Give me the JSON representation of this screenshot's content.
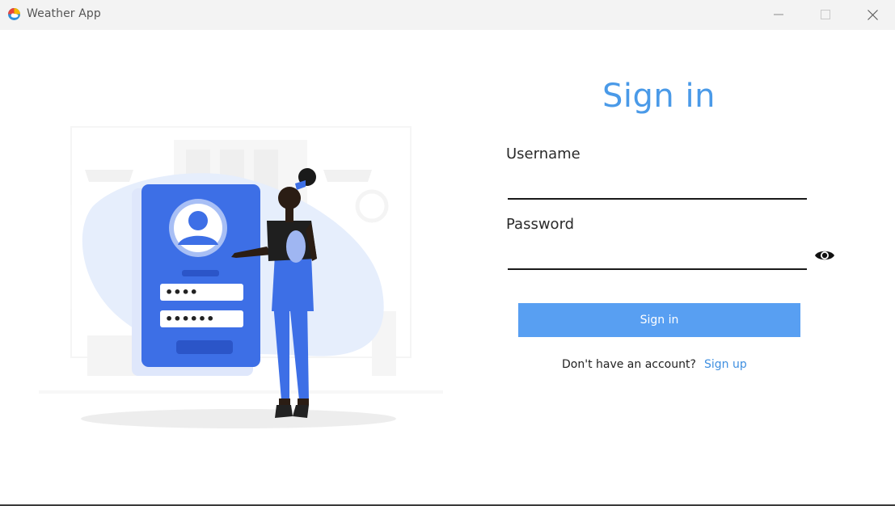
{
  "window": {
    "title": "Weather App",
    "controls": {
      "minimize_icon": "minimize-icon",
      "maximize_icon": "maximize-icon",
      "close_icon": "close-icon"
    }
  },
  "form": {
    "title": "Sign in",
    "username": {
      "label": "Username",
      "value": "",
      "placeholder": ""
    },
    "password": {
      "label": "Password",
      "value": "",
      "placeholder": "",
      "toggle_icon": "eye-icon"
    },
    "submit_label": "Sign in",
    "signup_prompt": "Don't have an account?",
    "signup_link": "Sign up"
  },
  "illustration": {
    "subject": "person-at-login-screen",
    "masked_username": "••••",
    "masked_password": "••••••"
  },
  "colors": {
    "accent": "#4a9ae8",
    "button": "#589ff2",
    "link": "#3f8fe0",
    "titlebar": "#f3f3f3",
    "illustration_blue": "#3d6fe6"
  }
}
